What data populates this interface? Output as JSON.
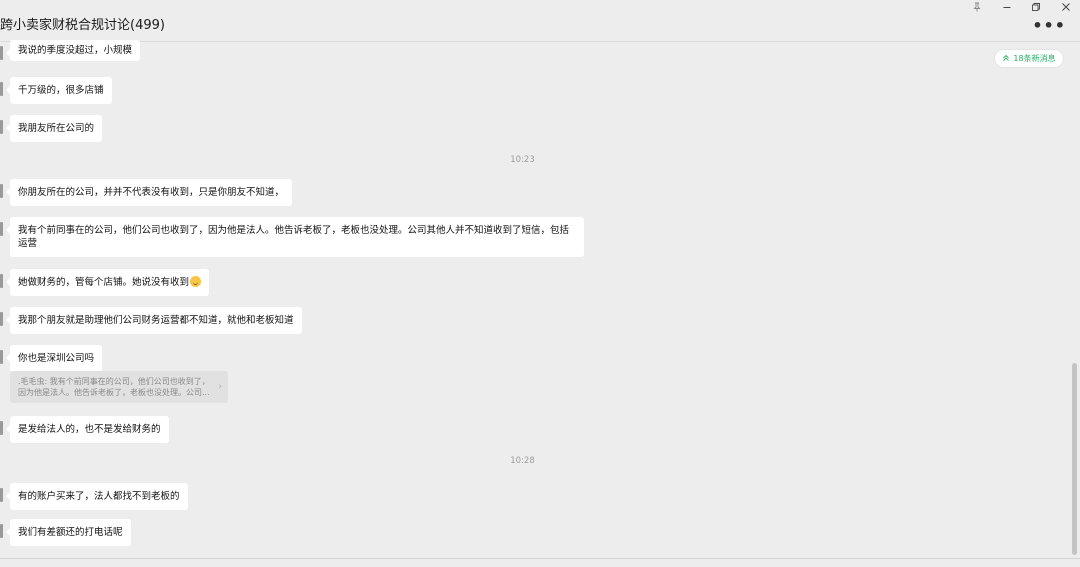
{
  "window": {
    "title": "跨小卖家财税合规讨论(499)",
    "more_icon": "more-horizontal-icon",
    "controls": [
      "pin-icon",
      "minimize-icon",
      "restore-icon",
      "close-icon"
    ]
  },
  "new_messages_badge": {
    "label": "18条新消息",
    "icon": "double-chevron-up-icon"
  },
  "messages": [
    {
      "text": "我说的季度没超过，小规模"
    },
    {
      "text": "千万级的，很多店铺"
    },
    {
      "text": "我朋友所在公司的"
    },
    {
      "text": "你朋友所在的公司，并并不代表没有收到，只是你朋友不知道，"
    },
    {
      "text": "我有个前同事在的公司，他们公司也收到了，因为他是法人。他告诉老板了，老板也没处理。公司其他人并不知道收到了短信，包括运营"
    },
    {
      "text": "她做财务的，管每个店铺。她说没有收到",
      "emoji": "grinning-sweat-emoji"
    },
    {
      "text": "我那个朋友就是助理他们公司财务运营都不知道，就他和老板知道"
    },
    {
      "text": "你也是深圳公司吗"
    },
    {
      "text": "是发给法人的，也不是发给财务的"
    },
    {
      "text": "有的账户买来了，法人都找不到老板的"
    },
    {
      "text": "我们有差额还的打电话呢"
    }
  ],
  "timestamps": [
    "10:23",
    "10:28"
  ],
  "quote": {
    "line1": ".毛毛虫: 我有个前同事在的公司，他们公司也收到了，",
    "line2": "因为他是法人。他告诉老板了，老板也没处理。公司...",
    "chevron": "›"
  }
}
